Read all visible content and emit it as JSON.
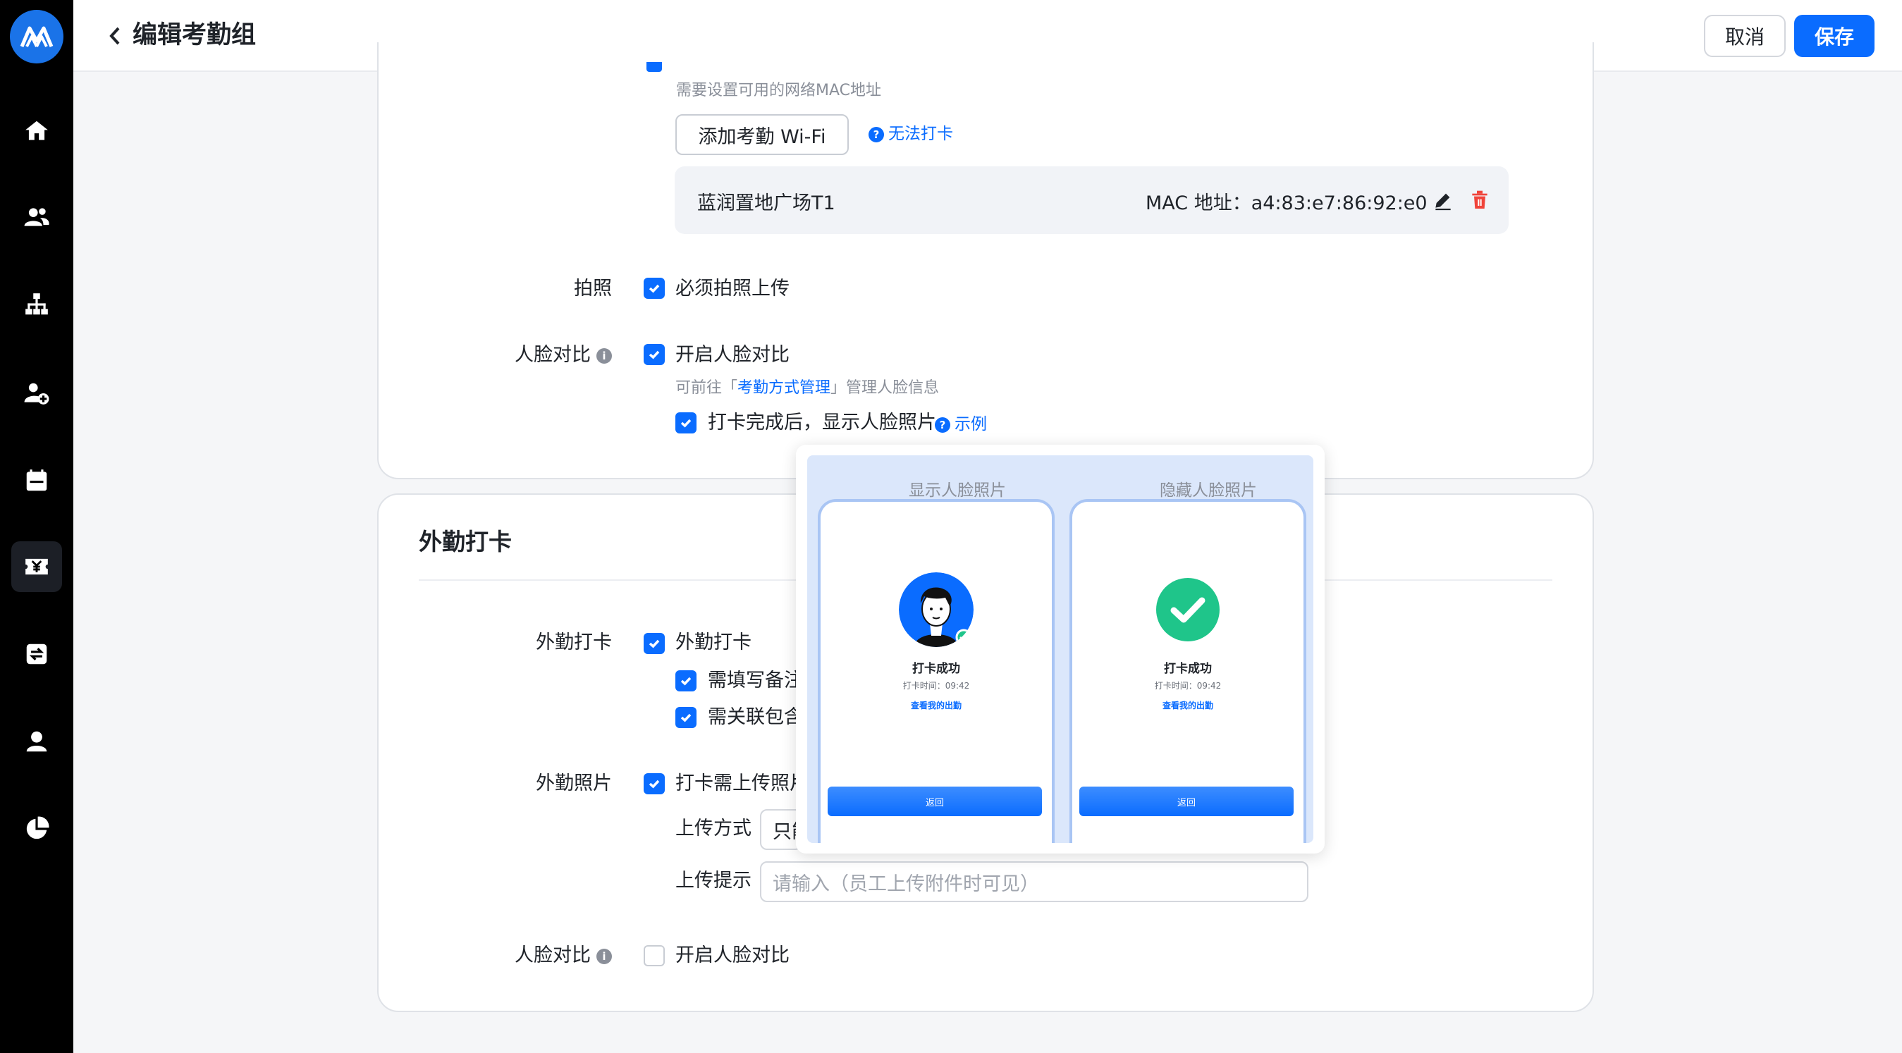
{
  "header": {
    "title": "编辑考勤组",
    "cancel_label": "取消",
    "save_label": "保存"
  },
  "sidebar": {
    "items": [
      {
        "icon": "home-icon"
      },
      {
        "icon": "users-icon"
      },
      {
        "icon": "org-chart-icon"
      },
      {
        "icon": "user-add-icon"
      },
      {
        "icon": "calendar-icon"
      },
      {
        "icon": "yen-ticket-icon",
        "active": true
      },
      {
        "icon": "approval-icon"
      },
      {
        "icon": "person-icon"
      },
      {
        "icon": "pie-chart-icon"
      }
    ]
  },
  "wifi": {
    "hint": "需要设置可用的网络MAC地址",
    "add_label": "添加考勤 Wi-Fi",
    "cannot_punch": "无法打卡",
    "entry_name": "蓝润置地广场T1",
    "entry_mac": "MAC 地址：a4:83:e7:86:92:e0"
  },
  "photo": {
    "label": "拍照",
    "option": "必须拍照上传",
    "checked": true
  },
  "face": {
    "label": "人脸对比",
    "option": "开启人脸对比",
    "checked": true,
    "hint_prefix": "可前往「",
    "hint_link": "考勤方式管理",
    "hint_suffix": "」管理人脸信息",
    "show_photo_option": "打卡完成后，显示人脸照片",
    "example_link": "示例"
  },
  "field": {
    "section_title": "外勤打卡",
    "label": "外勤打卡",
    "option": "外勤打卡",
    "remark_option": "需填写备注",
    "link_option": "需关联包含",
    "photo_label": "外勤照片",
    "photo_option": "打卡需上传照片",
    "upload_mode_label": "上传方式",
    "upload_mode_value": "只能",
    "upload_hint_label": "上传提示",
    "upload_hint_placeholder": "请输入（员工上传附件时可见）",
    "face_label": "人脸对比",
    "face_option": "开启人脸对比",
    "face_checked": false
  },
  "popover": {
    "show_title": "显示人脸照片",
    "hide_title": "隐藏人脸照片",
    "success": "打卡成功",
    "time": "打卡时间：09:42",
    "view_link": "查看我的出勤",
    "return_label": "返回",
    "accent": "#0a6cff",
    "success_color": "#1fc58a"
  }
}
